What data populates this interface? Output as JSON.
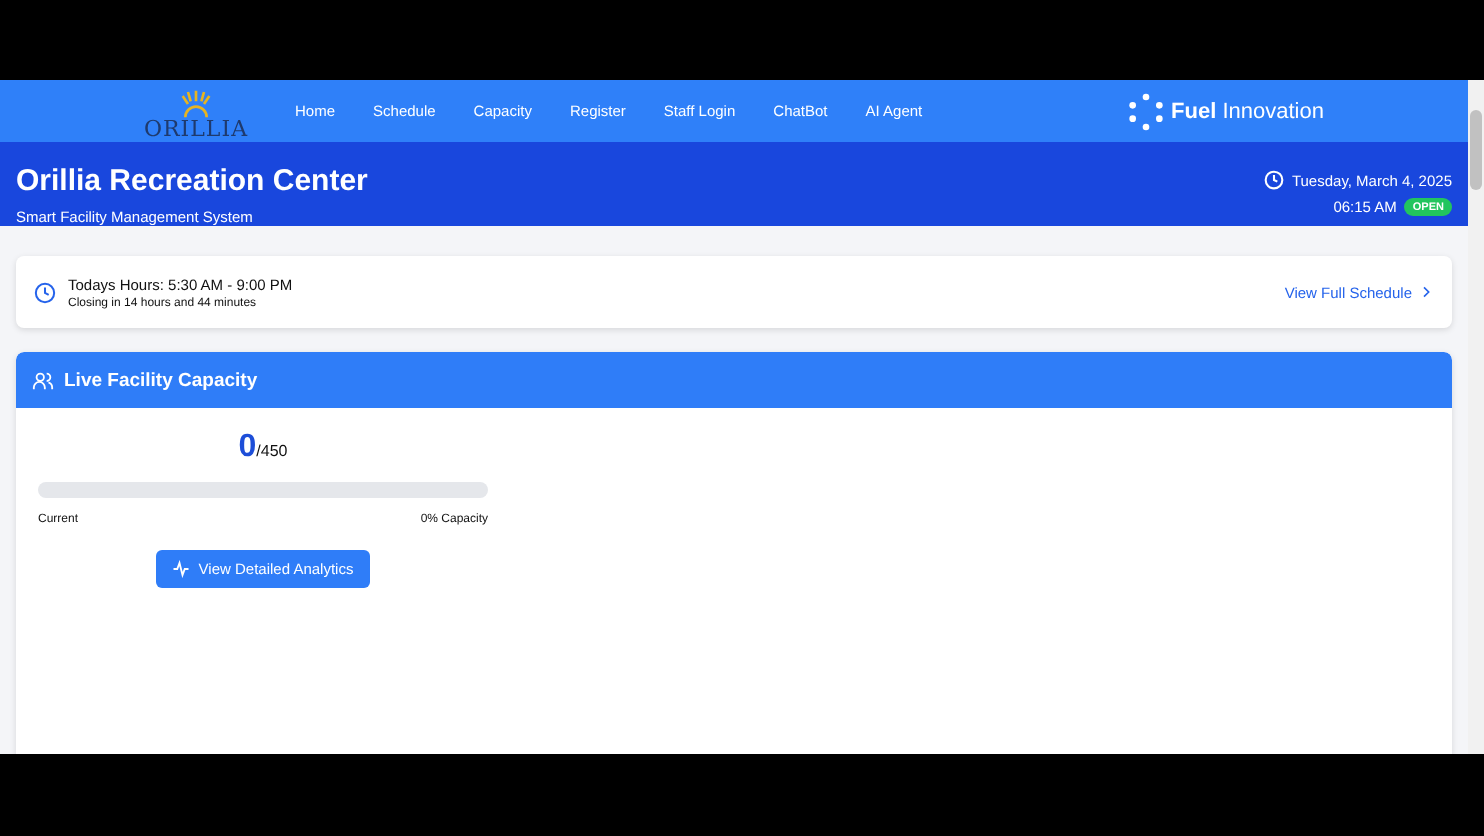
{
  "nav": {
    "logo": "ORILLIA",
    "items": [
      {
        "label": "Home"
      },
      {
        "label": "Schedule"
      },
      {
        "label": "Capacity"
      },
      {
        "label": "Register"
      },
      {
        "label": "Staff Login"
      },
      {
        "label": "ChatBot"
      },
      {
        "label": "AI Agent"
      }
    ],
    "partner_logo": "**Fuel** Innovation"
  },
  "header": {
    "title": "Orillia Recreation Center",
    "subtitle": "Smart Facility Management System",
    "date": "Tuesday, March 4, 2025",
    "time": "06:15 AM",
    "status": "OPEN"
  },
  "hours": {
    "title": "Todays Hours: 5:30 AM - 9:00 PM",
    "note": "Closing in 14 hours and 44 minutes",
    "link": "View Full Schedule"
  },
  "capacity": {
    "title": "Live Facility Capacity",
    "current": "0",
    "max": "/450",
    "level": 0,
    "left_label": "Current",
    "right_label": "0% Capacity",
    "button": "View Detailed Analytics"
  }
}
